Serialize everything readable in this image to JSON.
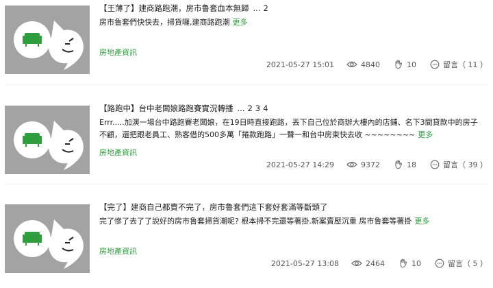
{
  "posts": [
    {
      "title": "【王薄了】建商路跑潮，房市鲁套血本無歸",
      "pages": [
        "2"
      ],
      "excerpt": "房市鲁套們快快去，掃貨囉,建商路跑潮",
      "more": "更多",
      "category": "房地產資訊",
      "date": "2021-05-27 15:01",
      "views": "4840",
      "claps": "10",
      "comments": "留言（ 11 ）"
    },
    {
      "title": "【路跑中】台中老闆娘路跑賽實況轉播",
      "pages": [
        "2",
        "3",
        "4"
      ],
      "excerpt": "Errr.....加演一場台中路跑賽老闆娘，在19日時直接跑路，丟下自己位於商辦大樓內的店鋪、名下3間貸款中的房子不顧，還把跟老員工、熟客借的500多萬「捲款跑路」一聲一和台中房東快去收 ~~~~~~~~",
      "more": "更多",
      "category": "房地產資訊",
      "date": "2021-05-27 14:29",
      "views": "9372",
      "claps": "18",
      "comments": "留言（ 39 ）"
    },
    {
      "title": "【完了】建商自己都賣不完了，房市鲁套們這下套好套滿等斷頭了",
      "pages": [],
      "excerpt": "完了慘了去了了說好的房市鲁套掃貨潮呢? 根本掃不完還等著掛.新案賣壓沉重 房市鲁套等著掛",
      "more": "更多",
      "category": "房地產資訊",
      "date": "2021-05-27 13:08",
      "views": "2464",
      "claps": "10",
      "comments": "留言（ 5 ）"
    }
  ],
  "colors": {
    "accent": "#2e9e3e",
    "thumb_bg": "#a3a3a3"
  },
  "icons": [
    "sofa-icon",
    "ghost-mascot-icon",
    "eye-icon",
    "clap-icon",
    "comment-icon"
  ]
}
